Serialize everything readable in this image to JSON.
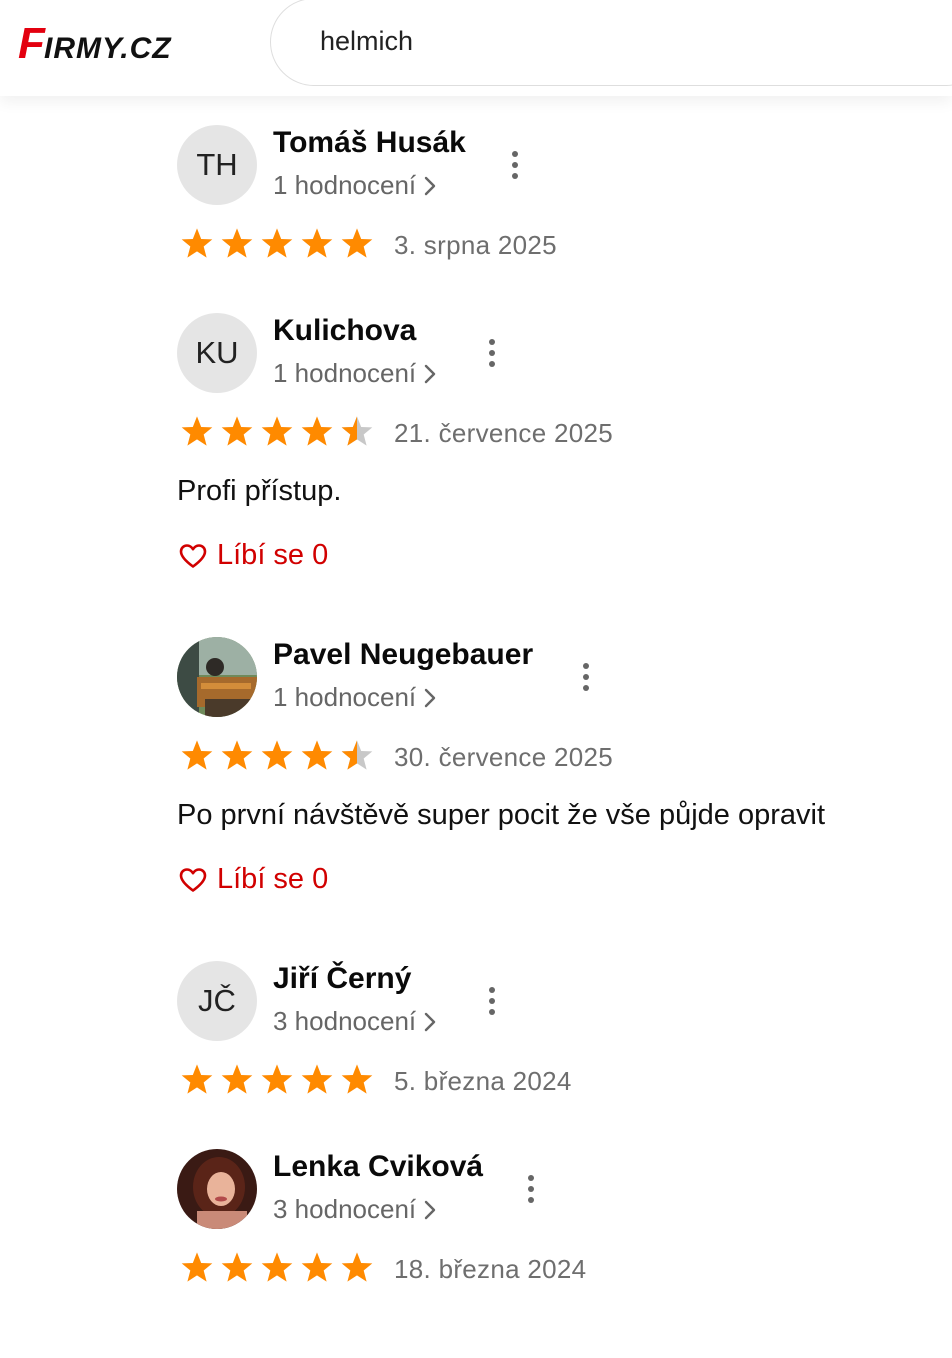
{
  "header": {
    "logo_text": "FIRMY.CZ",
    "search": {
      "value": "helmich"
    }
  },
  "colors": {
    "star": "#ff8a00",
    "star_empty": "#c8c8c8",
    "like": "#d10000",
    "brand": "#e3000f"
  },
  "reviews": [
    {
      "initials": "TH",
      "name": "Tomáš Husák",
      "count": "1 hodnocení",
      "rating": 5,
      "date": "3. srpna 2025"
    },
    {
      "initials": "KU",
      "name": "Kulichova",
      "count": "1 hodnocení",
      "rating": 4.5,
      "date": "21. července 2025",
      "text": "Profi přístup.",
      "like": "Líbí se 0"
    },
    {
      "initials": "",
      "avatar_icon": "photo-avatar-icon",
      "name": "Pavel Neugebauer",
      "count": "1 hodnocení",
      "rating": 4.5,
      "date": "30. července 2025",
      "text": "Po první návštěvě super pocit že vše půjde opravit",
      "like": "Líbí se 0"
    },
    {
      "initials": "JČ",
      "name": "Jiří Černý",
      "count": "3 hodnocení",
      "rating": 5,
      "date": "5. března 2024"
    },
    {
      "initials": "",
      "avatar_icon": "photo-avatar-icon",
      "name": "Lenka Cviková",
      "count": "3 hodnocení",
      "rating": 5,
      "date": "18. března 2024"
    }
  ]
}
